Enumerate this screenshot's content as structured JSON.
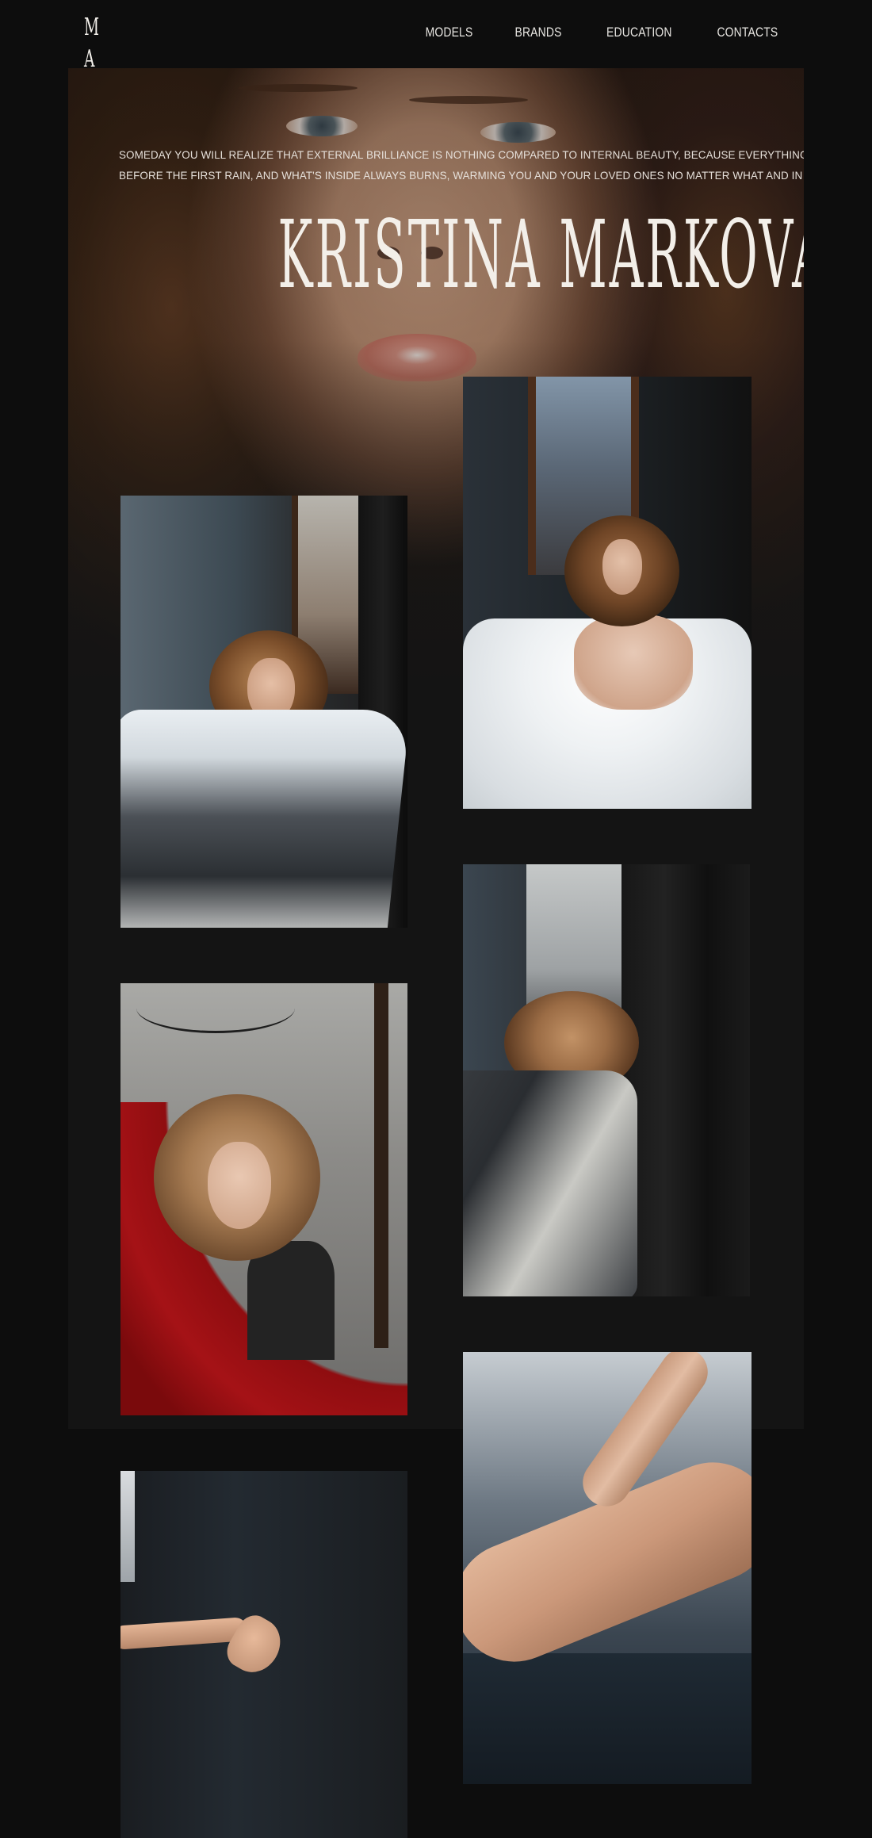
{
  "header": {
    "logo_line1": "M",
    "logo_line2": "A",
    "nav": [
      {
        "label": "MODELS"
      },
      {
        "label": "BRANDS"
      },
      {
        "label": "EDUCATION"
      },
      {
        "label": "CONTACTS"
      }
    ]
  },
  "hero": {
    "quote_line1": "Someday you will realize that external brilliance is nothing compared to internal beauty, because everything outside",
    "quote_line2": "before the first rain, and what's inside always burns, warming you and your loved ones no matter what and in any weather",
    "title": "KRISTINA MARKOVA"
  },
  "colors": {
    "background": "#0d0d0d",
    "panel": "#141414",
    "text": "#f3efe9"
  }
}
